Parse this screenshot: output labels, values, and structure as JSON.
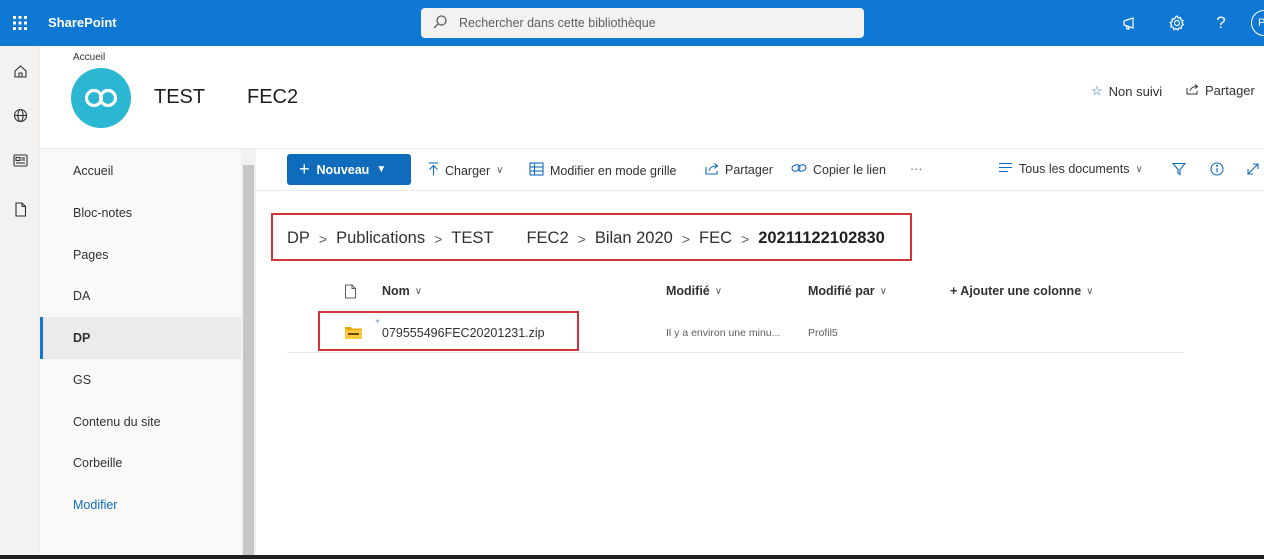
{
  "topbar": {
    "brand": "SharePoint",
    "search_placeholder": "Rechercher dans cette bibliothèque",
    "avatar_initial": "P",
    "help_label": "?"
  },
  "site": {
    "breadcrumb_top": "Accueil",
    "title": "TEST",
    "subtitle": "FEC2",
    "follow_label": "Non suivi",
    "share_label": "Partager"
  },
  "leftnav": {
    "items": [
      {
        "label": "Accueil"
      },
      {
        "label": "Bloc-notes"
      },
      {
        "label": "Pages"
      },
      {
        "label": "DA"
      },
      {
        "label": "DP"
      },
      {
        "label": "GS"
      },
      {
        "label": "Contenu du site"
      },
      {
        "label": "Corbeille"
      },
      {
        "label": "Modifier"
      }
    ],
    "active": "DP"
  },
  "commandbar": {
    "new_label": "Nouveau",
    "upload_label": "Charger",
    "grid_label": "Modifier en mode grille",
    "share_label": "Partager",
    "copylink_label": "Copier le lien",
    "more_label": "···",
    "view_label": "Tous les documents"
  },
  "breadcrumb": {
    "items": [
      "DP",
      "Publications",
      "TEST",
      "FEC2",
      "Bilan 2020",
      "FEC"
    ],
    "current": "20211122102830"
  },
  "table": {
    "columns": {
      "name": "Nom",
      "modified": "Modifié",
      "modified_by": "Modifié par",
      "add_column": "+ Ajouter une colonne"
    },
    "rows": [
      {
        "name": "079555496FEC20201231.zip",
        "modified": "Il y a environ une minu...",
        "modified_by": "Profil5"
      }
    ]
  },
  "colors": {
    "brand_blue": "#0f78d4",
    "accent": "#0f6cbd",
    "highlight_red": "#d13438",
    "logo_teal": "#2bb6d2"
  }
}
